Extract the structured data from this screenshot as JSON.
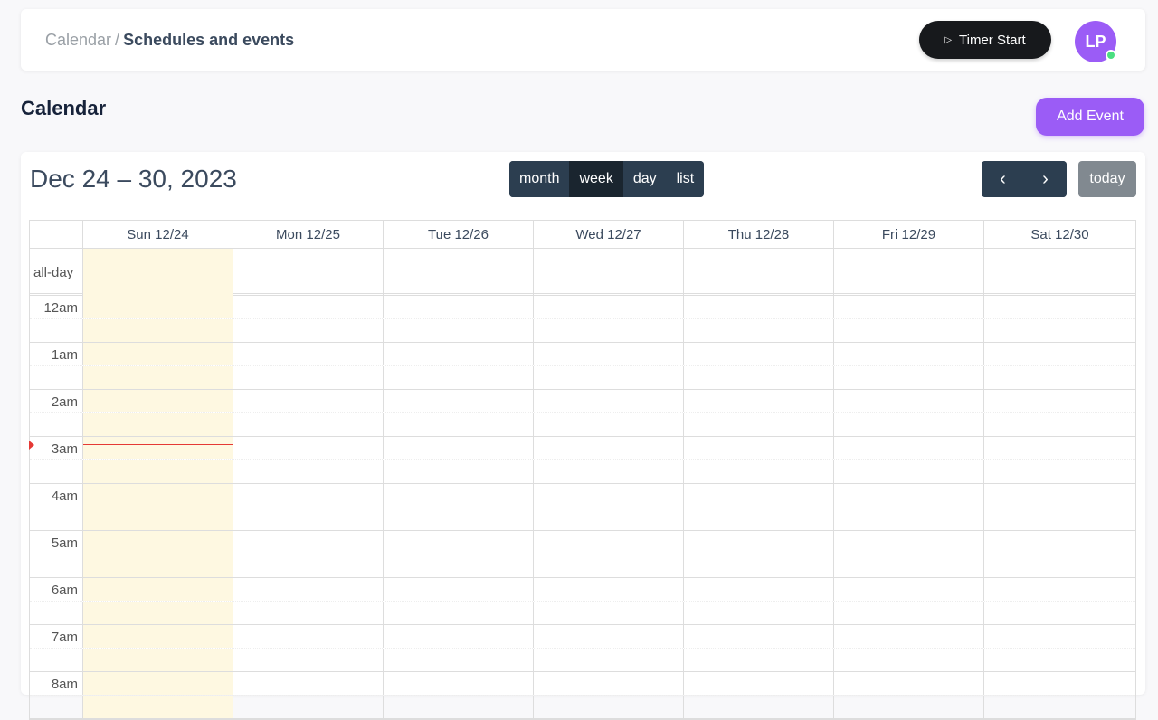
{
  "breadcrumb": {
    "parent": "Calendar",
    "separator": "/",
    "current": "Schedules and events"
  },
  "timer": {
    "icon": "play-icon",
    "label": "Timer Start"
  },
  "user": {
    "initials": "LP",
    "status": "online"
  },
  "page": {
    "title": "Calendar",
    "add_event_label": "Add Event"
  },
  "calendar": {
    "range_title": "Dec 24 – 30, 2023",
    "views": [
      "month",
      "week",
      "day",
      "list"
    ],
    "active_view": "week",
    "prev_icon": "chevron-left-icon",
    "next_icon": "chevron-right-icon",
    "today_label": "today",
    "allday_label": "all-day",
    "days": [
      "Sun 12/24",
      "Mon 12/25",
      "Tue 12/26",
      "Wed 12/27",
      "Thu 12/28",
      "Fri 12/29",
      "Sat 12/30"
    ],
    "today_index": 0,
    "hours": [
      "12am",
      "1am",
      "2am",
      "3am",
      "4am",
      "5am",
      "6am",
      "7am",
      "8am"
    ]
  },
  "colors": {
    "accent": "#9b5cf6",
    "dark": "#2c3e50",
    "today_bg": "#fef8e1",
    "now_indicator": "#e53935"
  }
}
